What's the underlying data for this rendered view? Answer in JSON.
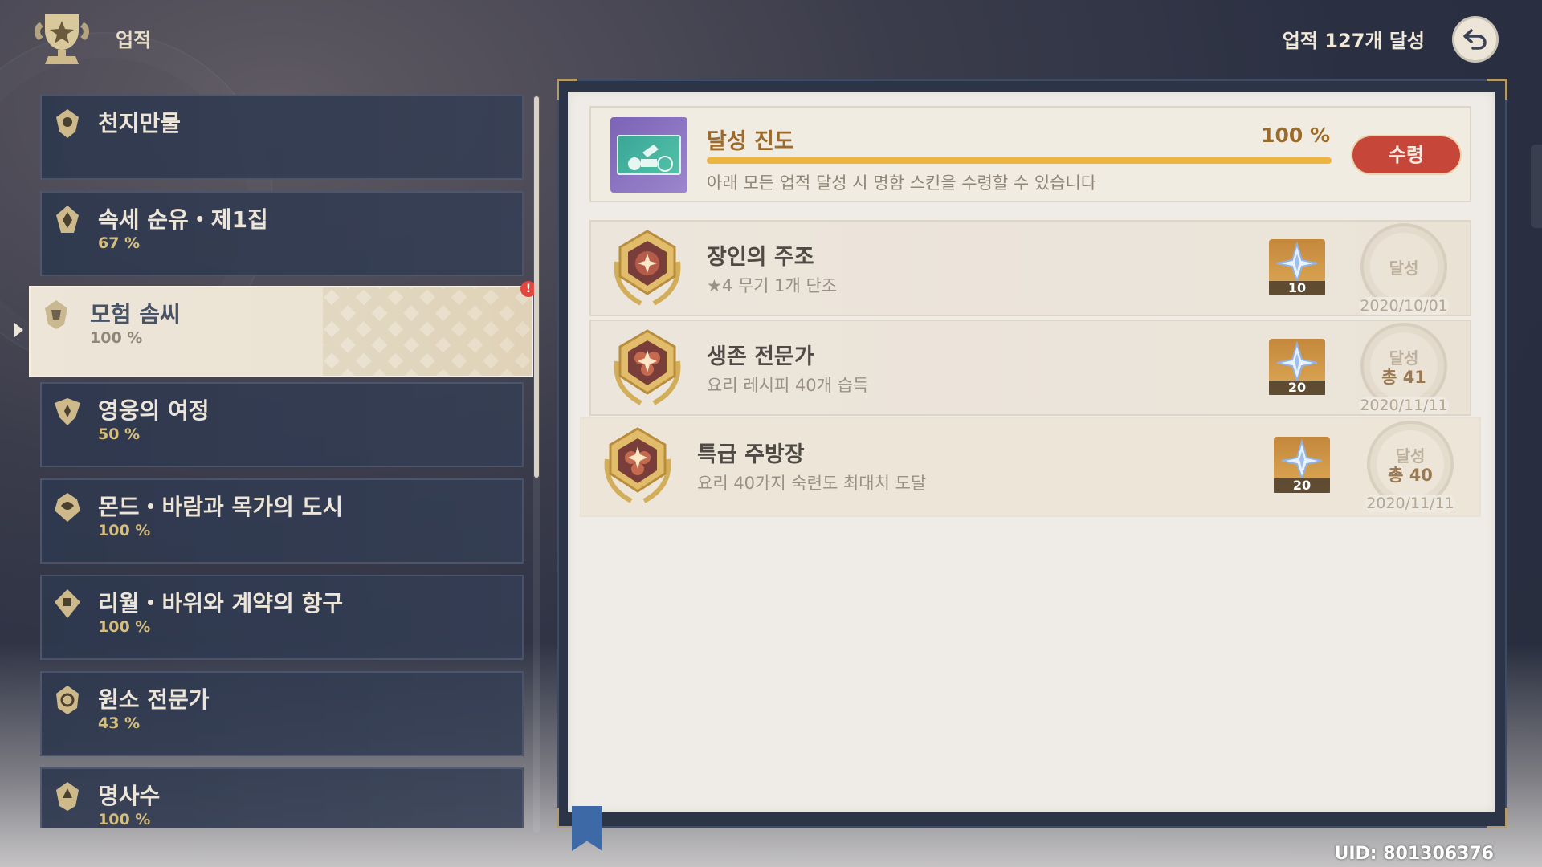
{
  "header": {
    "title": "업적",
    "achieved_count": "업적 127개 달성"
  },
  "categories": [
    {
      "name": "천지만물",
      "pct": ""
    },
    {
      "name": "속세 순유・제1집",
      "pct": "67 %"
    },
    {
      "name": "모험 솜씨",
      "pct": "100 %",
      "selected": true
    },
    {
      "name": "영웅의 여정",
      "pct": "50 %"
    },
    {
      "name": "몬드・바람과 목가의 도시",
      "pct": "100 %"
    },
    {
      "name": "리월・바위와 계약의 항구",
      "pct": "100 %"
    },
    {
      "name": "원소 전문가",
      "pct": "43 %"
    },
    {
      "name": "명사수",
      "pct": "100 %"
    }
  ],
  "notification": "!",
  "progress": {
    "title": "달성 진도",
    "percent_label": "100 %",
    "percent": 100,
    "description": "아래 모든 업적 달성 시 명함 스킨을 수령할 수 있습니다",
    "claim_label": "수령"
  },
  "achievements": [
    {
      "title": "장인의 주조",
      "description": "★4 무기 1개 단조",
      "reward": "10",
      "stamp_label": "달성",
      "stamp_total": "",
      "date": "2020/10/01"
    },
    {
      "title": "생존 전문가",
      "description": "요리 레시피 40개 습득",
      "reward": "20",
      "stamp_label": "달성",
      "stamp_total": "총 41",
      "date": "2020/11/11"
    },
    {
      "title": "특급 주방장",
      "description": "요리 40가지 숙련도 최대치 도달",
      "reward": "20",
      "stamp_label": "달성",
      "stamp_total": "총 40",
      "date": "2020/11/11"
    }
  ],
  "uid": "UID: 801306376",
  "colors": {
    "accent_gold": "#9b6a2d",
    "progress_fill": "#ecb540",
    "claim_button": "#c6463a",
    "list_bg": "#2e384e",
    "paper": "#efebe6"
  }
}
